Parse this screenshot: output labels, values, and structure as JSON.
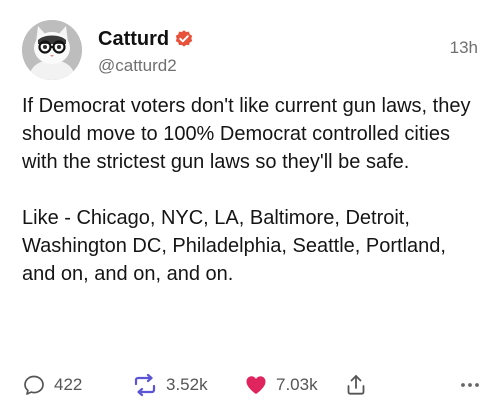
{
  "author": {
    "display_name": "Catturd",
    "handle": "@catturd2",
    "avatar_icon": "cat-with-glasses-avatar",
    "verified_icon": "verified-badge-icon",
    "verified_color": "#e8513a"
  },
  "timestamp": "13h",
  "tweet": {
    "paragraphs": [
      "If Democrat voters don't like current gun laws, they should move to 100% Democrat controlled cities with the strictest gun laws so they'll be safe.",
      "Like - Chicago, NYC, LA, Baltimore, Detroit, Washington DC, Philadelphia, Seattle, Portland, and on, and on, and on."
    ]
  },
  "actions": {
    "reply": {
      "icon": "reply-icon",
      "count": "422"
    },
    "repost": {
      "icon": "repost-icon",
      "count": "3.52k",
      "color": "#5b55d6"
    },
    "like": {
      "icon": "heart-icon",
      "count": "7.03k",
      "color": "#e0245e"
    },
    "share": {
      "icon": "share-icon"
    },
    "more": {
      "icon": "more-icon"
    }
  }
}
